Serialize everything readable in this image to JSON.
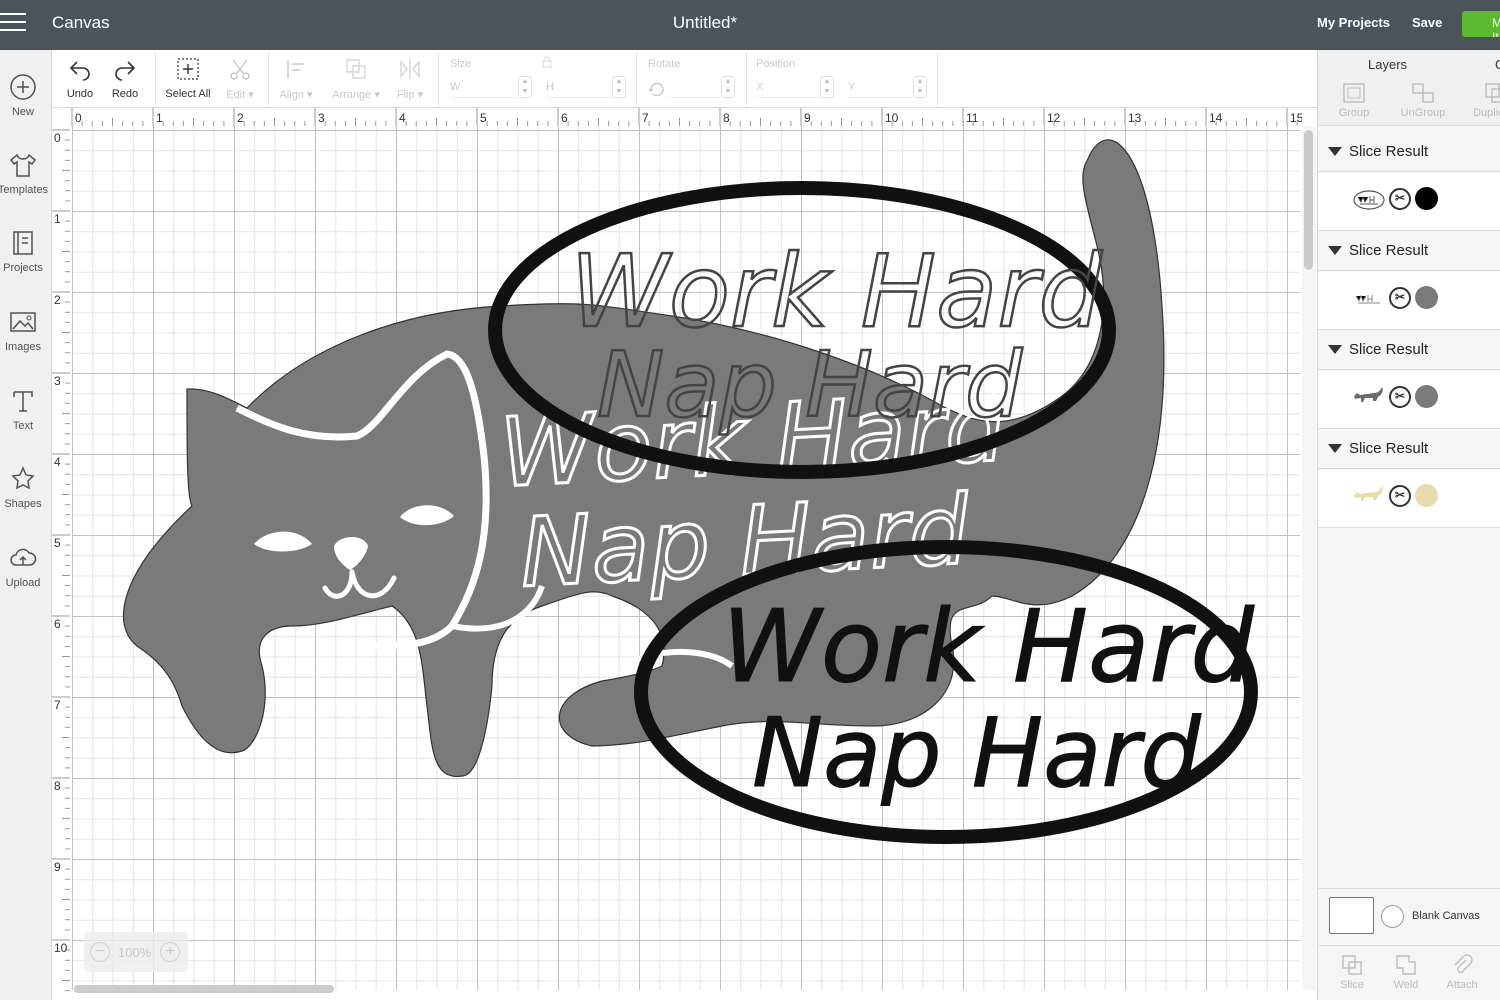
{
  "topbar": {
    "app_name": "Canvas",
    "doc_title": "Untitled*",
    "my_projects": "My Projects",
    "save": "Save",
    "make": "Make It"
  },
  "leftbar": {
    "items": [
      {
        "label": "New",
        "icon": "plus-circle-icon"
      },
      {
        "label": "Templates",
        "icon": "tshirt-icon"
      },
      {
        "label": "Projects",
        "icon": "projects-icon"
      },
      {
        "label": "Images",
        "icon": "image-icon"
      },
      {
        "label": "Text",
        "icon": "text-icon"
      },
      {
        "label": "Shapes",
        "icon": "shapes-icon"
      },
      {
        "label": "Upload",
        "icon": "upload-cloud-icon"
      }
    ]
  },
  "toolbar": {
    "undo": "Undo",
    "redo": "Redo",
    "select_all": "Select All",
    "edit": "Edit",
    "align": "Align",
    "arrange": "Arrange",
    "flip": "Flip",
    "size_label": "Size",
    "w_label": "W",
    "h_label": "H",
    "rotate_label": "Rotate",
    "position_label": "Position",
    "x_label": "X",
    "y_label": "Y"
  },
  "rulers": {
    "horizontal": [
      "0",
      "1",
      "2",
      "3",
      "4",
      "5",
      "6",
      "7",
      "8",
      "9",
      "10",
      "11",
      "12",
      "13",
      "14",
      "15"
    ],
    "vertical": [
      "0",
      "1",
      "2",
      "3",
      "4",
      "5",
      "6",
      "7",
      "8",
      "9",
      "10"
    ]
  },
  "canvas": {
    "text_line1": "Work Hard",
    "text_line2": "Nap Hard",
    "colors": {
      "cat": "#7a7a7a",
      "oval": "#111111",
      "white": "#ffffff"
    }
  },
  "zoom": {
    "label": "100%"
  },
  "layers_panel": {
    "title": "Layers",
    "title_clipped": "C",
    "tools": [
      "Group",
      "UnGroup",
      "Duplicate"
    ],
    "layers": [
      {
        "name": "Slice Result",
        "thumb": "text-oval",
        "color": "#000000"
      },
      {
        "name": "Slice Result",
        "thumb": "text-oval",
        "color": "#7a7a7a"
      },
      {
        "name": "Slice Result",
        "thumb": "cat",
        "color": "#7a7a7a"
      },
      {
        "name": "Slice Result",
        "thumb": "cat",
        "color": "#e8d9b0"
      }
    ],
    "blank_canvas": "Blank Canvas",
    "bottom_tools": [
      "Slice",
      "Weld",
      "Attach"
    ]
  }
}
